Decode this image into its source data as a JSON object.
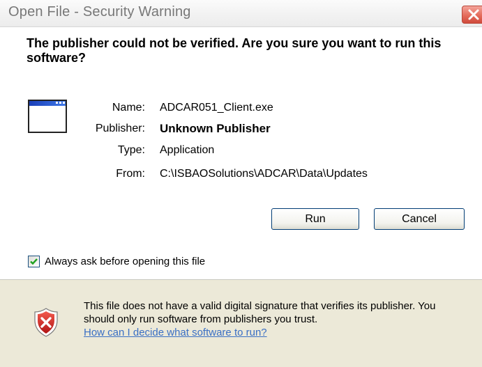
{
  "window": {
    "title": "Open File - Security Warning",
    "close_icon": "close-icon",
    "accent_color": "#e46c5c"
  },
  "main": {
    "headline": "The publisher could not be verified.  Are you sure you want to run this software?",
    "app_icon": "application-window-icon",
    "details": [
      {
        "label": "Name:",
        "value": "ADCAR051_Client.exe"
      },
      {
        "label": "Publisher:",
        "value": "Unknown Publisher"
      },
      {
        "label": "Type:",
        "value": "Application"
      },
      {
        "label": "From:",
        "value": "C:\\ISBAOSolutions\\ADCAR\\Data\\Updates"
      }
    ],
    "buttons": {
      "run": "Run",
      "cancel": "Cancel"
    },
    "checkbox": {
      "label": "Always ask before opening this file",
      "checked": true
    }
  },
  "footer": {
    "shield_icon": "security-shield-icon",
    "text": "This file does not have a valid digital signature that verifies its publisher.  You should only run software from publishers you trust.",
    "link": "How can I decide what software to run?",
    "link_color": "#3a6fc4"
  }
}
